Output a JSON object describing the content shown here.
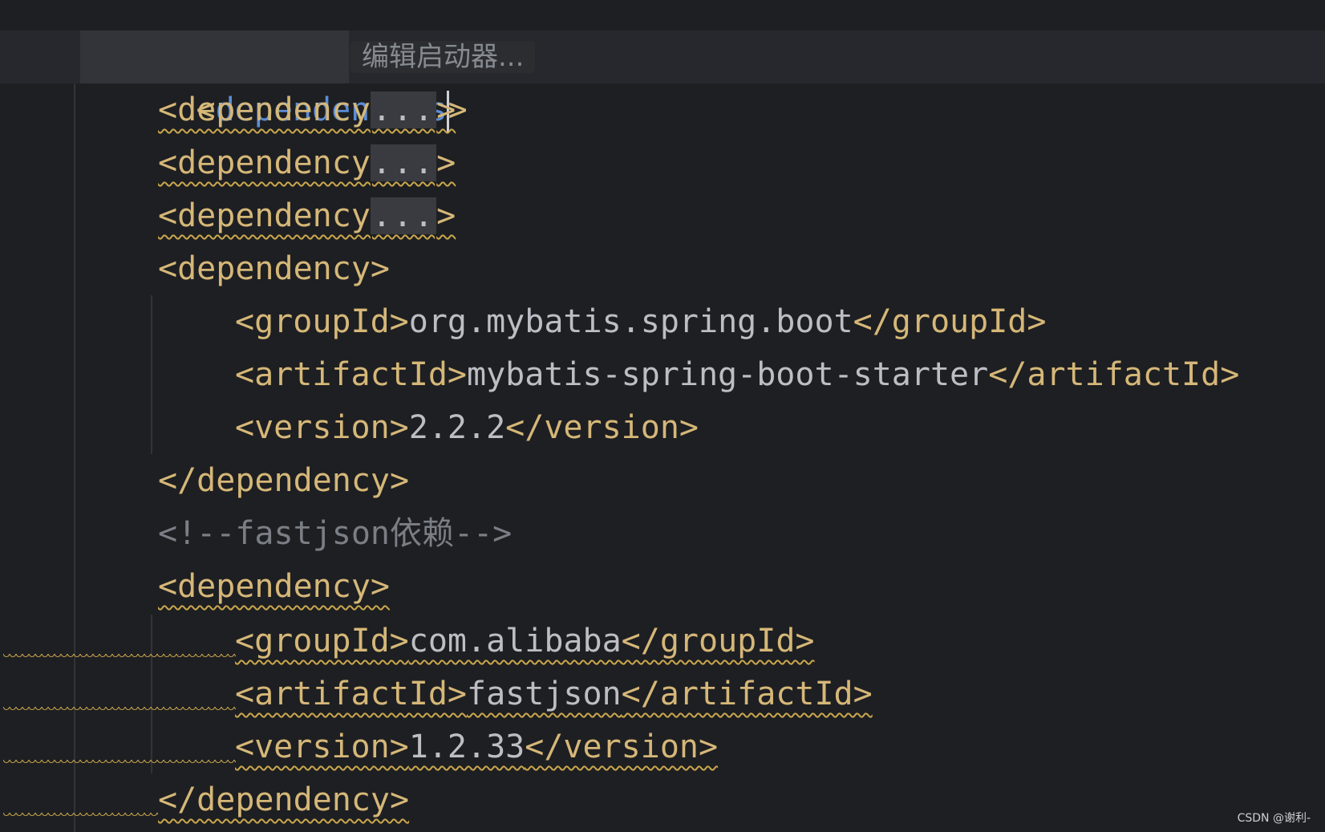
{
  "hint": {
    "label": "编辑启动器..."
  },
  "lines": [
    {
      "open": "<",
      "name": "dependencies",
      "close": ">"
    },
    {
      "open": "<dependency",
      "fold": "...",
      "close": ">"
    },
    {
      "open": "<dependency",
      "fold": "...",
      "close": ">"
    },
    {
      "open": "<dependency",
      "fold": "...",
      "close": ">"
    },
    {
      "tag": "<dependency>"
    },
    {
      "open": "<groupId>",
      "value": "org.mybatis.spring.boot",
      "close": "</groupId>"
    },
    {
      "open": "<artifactId>",
      "value": "mybatis-spring-boot-starter",
      "close": "</artifactId>"
    },
    {
      "open": "<version>",
      "value": "2.2.2",
      "close": "</version>"
    },
    {
      "tag": "</dependency>"
    },
    {
      "comment": "<!--fastjson依赖-->"
    },
    {
      "tag": "<dependency>"
    },
    {
      "open": "<groupId>",
      "value": "com.alibaba",
      "close": "</groupId>"
    },
    {
      "open": "<artifactId>",
      "value": "fastjson",
      "close": "</artifactId>"
    },
    {
      "open": "<version>",
      "value": "1.2.33",
      "close": "</version>"
    },
    {
      "tag": "</dependency>"
    }
  ],
  "watermark": "CSDN @谢利-",
  "colors": {
    "background": "#1e1f22",
    "tag": "#d5b778",
    "current_tag": "#5c8dd6",
    "comment": "#7a7e85",
    "warning": "#c9a74d"
  }
}
